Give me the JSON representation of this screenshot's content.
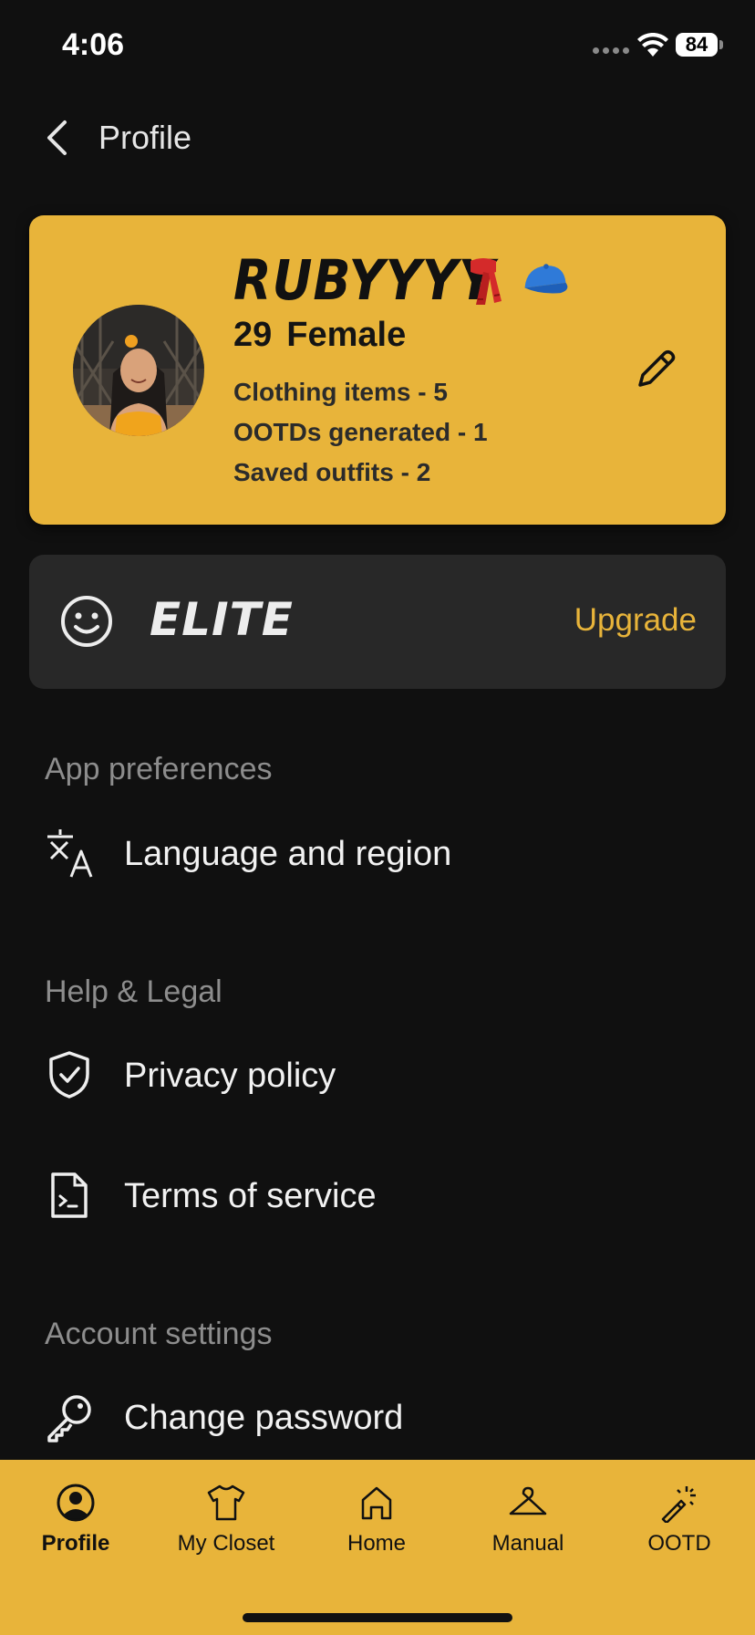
{
  "status_bar": {
    "time": "4:06",
    "battery": "84"
  },
  "header": {
    "title": "Profile"
  },
  "profile": {
    "name": "RUBYYYY",
    "age": "29",
    "gender": "Female",
    "emojis": [
      "scarf-icon",
      "cap-icon"
    ],
    "stats": [
      "Clothing items - 5",
      "OOTDs generated - 1",
      "Saved outfits - 2"
    ]
  },
  "membership": {
    "tier": "ELITE",
    "upgrade_label": "Upgrade"
  },
  "sections": [
    {
      "heading": "App preferences",
      "items": [
        {
          "label": "Language and region",
          "icon": "translate-icon"
        }
      ]
    },
    {
      "heading": "Help & Legal",
      "items": [
        {
          "label": "Privacy policy",
          "icon": "shield-check-icon"
        },
        {
          "label": "Terms of service",
          "icon": "document-terminal-icon"
        }
      ]
    },
    {
      "heading": "Account settings",
      "items": [
        {
          "label": "Change password",
          "icon": "key-icon"
        }
      ]
    }
  ],
  "bottom_nav": [
    {
      "label": "Profile",
      "icon": "profile-icon",
      "active": true
    },
    {
      "label": "My Closet",
      "icon": "shirt-icon",
      "active": false
    },
    {
      "label": "Home",
      "icon": "home-icon",
      "active": false
    },
    {
      "label": "Manual",
      "icon": "hanger-icon",
      "active": false
    },
    {
      "label": "OOTD",
      "icon": "magic-wand-icon",
      "active": false
    }
  ],
  "colors": {
    "accent": "#e8b43a",
    "background": "#101010",
    "card_dark": "#282828"
  }
}
